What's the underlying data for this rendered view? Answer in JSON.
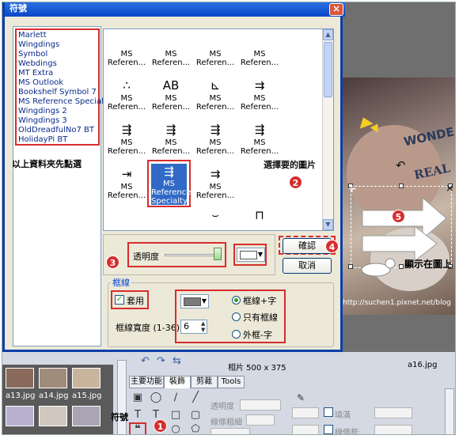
{
  "dialog": {
    "title": "符號",
    "close_label": "×",
    "font_list": [
      "Marlett",
      "Wingdings",
      "Symbol",
      "Webdings",
      "MT Extra",
      "MS Outlook",
      "Bookshelf Symbol 7",
      "MS Reference Specialty",
      "Wingdings 2",
      "Wingdings 3",
      "OldDreadfulNo7 BT",
      "HolidayPi BT"
    ],
    "grid_labels": [
      "MS\nReferen...",
      "MS\nReferen...",
      "MS\nReferen...",
      "MS\nReferen...",
      "MS\nReferen...",
      "MS\nReferen...",
      "MS\nReferen...",
      "MS\nReferen...",
      "MS\nReferen...",
      "MS\nReferen...",
      "MS\nReferen...",
      "MS\nReferen...",
      "MS\nReferen...",
      "MS\nReferen..."
    ],
    "selected_cell_label": "MS\nReference\nSpecialty",
    "opacity_label": "透明度",
    "opacity_value": 1.0,
    "ok_label": "確認",
    "cancel_label": "取消",
    "border_group_label": "框線",
    "apply_label": "套用",
    "border_width_label": "框線寬度 (1-36)",
    "border_width_value": "6",
    "radio_options": [
      "框線+字",
      "只有框線",
      "外框-字"
    ],
    "radio_selected": 0,
    "accent_color": "#d62d2d"
  },
  "annotations": {
    "note_left": "以上資料夾先點選",
    "note_select": "選擇要的圖片",
    "note_show": "顯示在圖上",
    "note_symbol": "符號",
    "badges": [
      "1",
      "2",
      "3",
      "4",
      "5"
    ],
    "url_overlay": "http://suchen1.pixnet.net/blog"
  },
  "photo": {
    "wonder_text": "WONDE",
    "re_text": "REAL"
  },
  "app": {
    "photo_size": "相片 500 x 375",
    "filename": "a16.jpg",
    "tabs": [
      "主要功能",
      "裝飾",
      "剪裁",
      "Tools"
    ],
    "active_tab": 1,
    "thumb_names": [
      "a13.jpg",
      "a14.jpg",
      "a15.jpg"
    ],
    "prop_opacity": "透明度",
    "prop_border": "線條粗細",
    "prop_fill": "填滿",
    "prop_border_color": "線條框:"
  }
}
